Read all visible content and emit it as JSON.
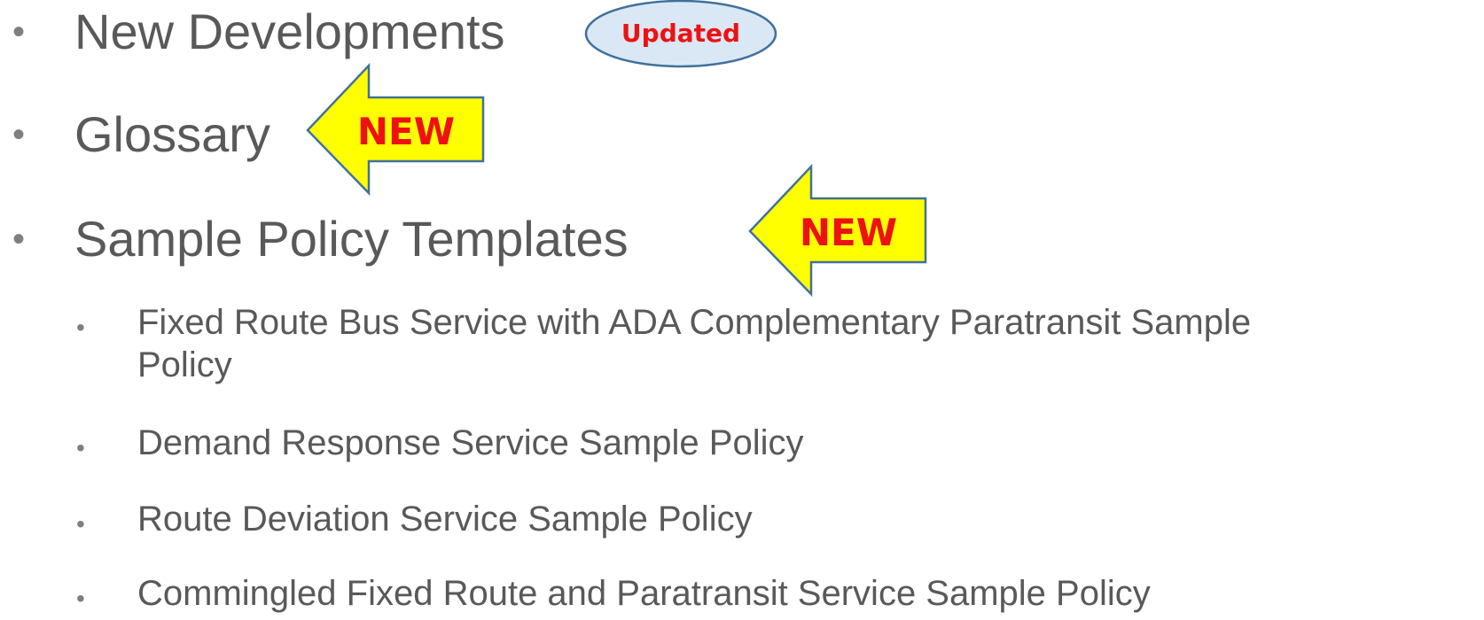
{
  "items": [
    {
      "bullet": "•",
      "text": "New Developments",
      "badge": "Updated"
    },
    {
      "bullet": "•",
      "text": "Glossary",
      "badge": "NEW"
    },
    {
      "bullet": "•",
      "text": "Sample Policy Templates",
      "badge": "NEW"
    }
  ],
  "subitems": [
    {
      "bullet": "•",
      "text_line1": "Fixed Route Bus Service with ADA Complementary Paratransit Sample",
      "text_line2": "Policy"
    },
    {
      "bullet": "•",
      "text": "Demand Response Service Sample Policy"
    },
    {
      "bullet": "•",
      "text": "Route Deviation Service Sample Policy"
    },
    {
      "bullet": "•",
      "text": "Commingled Fixed Route and Paratransit Service Sample Policy"
    }
  ],
  "colors": {
    "text": "#595959",
    "arrow_fill": "#ffff00",
    "arrow_stroke": "#41719c",
    "badge_text": "#ee1111",
    "oval_fill": "#dae8f5",
    "oval_stroke": "#41719c"
  }
}
